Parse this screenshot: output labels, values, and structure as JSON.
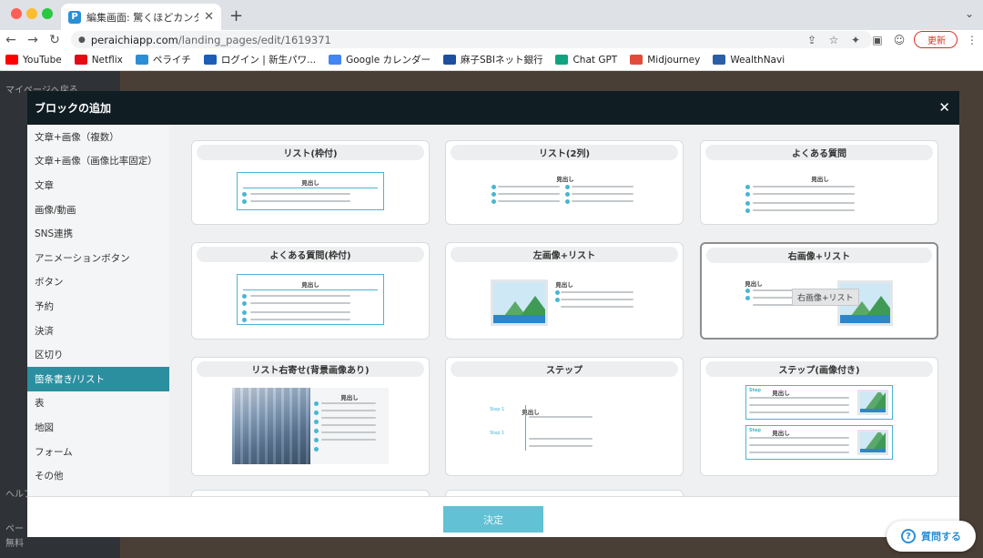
{
  "browser": {
    "tab_title": "編集画面: 驚くほどカンタン！無料",
    "url_domain": "peraichiapp.com",
    "url_path": "/landing_pages/edit/1619371",
    "update_label": "更新",
    "bookmarks": [
      {
        "label": "YouTube",
        "icon": "youtube-icon",
        "color": "#ff0000"
      },
      {
        "label": "Netflix",
        "icon": "netflix-icon",
        "color": "#e50914"
      },
      {
        "label": "ペライチ",
        "icon": "peraichi-icon",
        "color": "#2b8fd6"
      },
      {
        "label": "ログイン | 新生パワ...",
        "icon": "power-icon",
        "color": "#1c5db8"
      },
      {
        "label": "Google カレンダー",
        "icon": "calendar-icon",
        "color": "#4285f4"
      },
      {
        "label": "麻子SBIネット銀行",
        "icon": "sbi-icon",
        "color": "#1d4fa0"
      },
      {
        "label": "Chat GPT",
        "icon": "chatgpt-icon",
        "color": "#10a37f"
      },
      {
        "label": "Midjourney",
        "icon": "midjourney-icon",
        "color": "#e24a3b"
      },
      {
        "label": "WealthNavi",
        "icon": "wealthnavi-icon",
        "color": "#2a5fa8"
      }
    ]
  },
  "background_page": {
    "mypage_back": "マイページへ戻る",
    "help": "ヘルプ",
    "page_label": "ペー",
    "free_label": "無料"
  },
  "modal": {
    "title": "ブロックの追加",
    "confirm_label": "決定",
    "categories": [
      {
        "label": "文章+画像（複数）"
      },
      {
        "label": "文章+画像（画像比率固定）"
      },
      {
        "label": "文章"
      },
      {
        "label": "画像/動画"
      },
      {
        "label": "SNS連携"
      },
      {
        "label": "アニメーションボタン"
      },
      {
        "label": "ボタン"
      },
      {
        "label": "予約"
      },
      {
        "label": "決済"
      },
      {
        "label": "区切り"
      },
      {
        "label": "箇条書き/リスト",
        "active": true
      },
      {
        "label": "表"
      },
      {
        "label": "地図"
      },
      {
        "label": "フォーム"
      },
      {
        "label": "その他"
      }
    ],
    "blocks": [
      {
        "title": "リスト(枠付)",
        "preview_heading": "見出し"
      },
      {
        "title": "リスト(2列)",
        "preview_heading": "見出し"
      },
      {
        "title": "よくある質問",
        "preview_heading": "見出し"
      },
      {
        "title": "よくある質問(枠付)",
        "preview_heading": "見出し"
      },
      {
        "title": "左画像+リスト",
        "preview_heading": "見出し"
      },
      {
        "title": "右画像+リスト",
        "preview_heading": "見出し",
        "selected": true,
        "tooltip": "右画像+リスト"
      },
      {
        "title": "リスト右寄せ(背景画像あり)",
        "preview_heading": "見出し"
      },
      {
        "title": "ステップ",
        "preview_heading": "見出し",
        "step_labels": [
          "Step 1",
          "Step 1"
        ]
      },
      {
        "title": "ステップ(画像付き)",
        "preview_heading": "見出し",
        "step_labels": [
          "Step",
          "Step"
        ]
      }
    ]
  },
  "help_button": {
    "label": "質問する"
  },
  "colors": {
    "accent": "#2b8fa0",
    "modal_header": "#101d23",
    "confirm": "#62c1d4"
  }
}
